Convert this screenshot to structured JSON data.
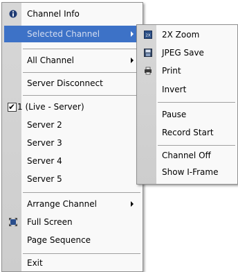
{
  "main_menu": {
    "items": [
      {
        "label": "Channel Info",
        "icon": "info-icon"
      },
      {
        "label": "Selected Channel",
        "submenu": true,
        "highlighted": true
      },
      {
        "label": "All Channel",
        "submenu": true
      },
      {
        "label": "Server Disconnect"
      },
      {
        "label": "1 (Live - Server)",
        "checked": true
      },
      {
        "label": "Server 2"
      },
      {
        "label": "Server 3"
      },
      {
        "label": "Server 4"
      },
      {
        "label": "Server 5"
      },
      {
        "label": "Arrange Channel",
        "submenu": true
      },
      {
        "label": "Full Screen",
        "icon": "full-screen-icon"
      },
      {
        "label": "Page Sequence"
      },
      {
        "label": "Exit"
      }
    ]
  },
  "sub_menu": {
    "items": [
      {
        "label": "2X Zoom",
        "icon": "zoom-icon"
      },
      {
        "label": "JPEG Save",
        "icon": "save-icon"
      },
      {
        "label": "Print",
        "icon": "printer-icon"
      },
      {
        "label": "Invert"
      },
      {
        "label": "Pause"
      },
      {
        "label": "Record Start"
      },
      {
        "label": "Channel Off"
      },
      {
        "label": "Show I-Frame"
      }
    ]
  },
  "colors": {
    "highlight": "#3d72c7",
    "gutter": "#d3d3d3",
    "menu_bg": "#f9f9f9"
  }
}
